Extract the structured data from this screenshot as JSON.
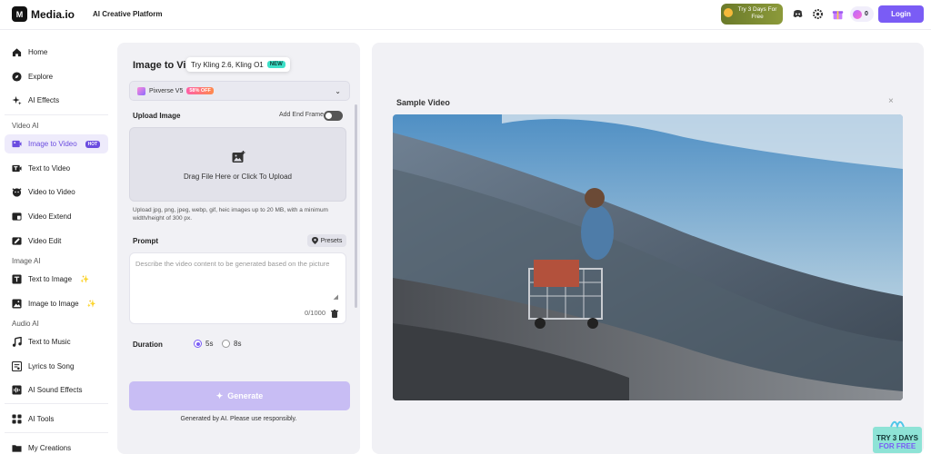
{
  "header": {
    "logo": "Media.io",
    "platform": "AI Creative Platform",
    "promo": "Try 3 Days For Free",
    "credits": "0",
    "login": "Login"
  },
  "sidebar": {
    "items": [
      {
        "label": "Home",
        "icon": "home-icon"
      },
      {
        "label": "Explore",
        "icon": "compass-icon"
      },
      {
        "label": "AI Effects",
        "icon": "sparkles-icon"
      }
    ],
    "sections": [
      {
        "title": "Video AI",
        "items": [
          {
            "label": "Image to Video",
            "badge": "HOT",
            "active": true
          },
          {
            "label": "Text to Video"
          },
          {
            "label": "Video to Video"
          },
          {
            "label": "Video Extend"
          },
          {
            "label": "Video Edit"
          }
        ]
      },
      {
        "title": "Image AI",
        "items": [
          {
            "label": "Text to Image"
          },
          {
            "label": "Image to Image"
          }
        ]
      },
      {
        "title": "Audio AI",
        "items": [
          {
            "label": "Text to Music"
          },
          {
            "label": "Lyrics to Song"
          },
          {
            "label": "AI Sound Effects"
          }
        ]
      }
    ],
    "tools": "AI Tools",
    "creations": "My Creations"
  },
  "panel": {
    "title": "Image to Vi",
    "tooltip": "Try Kling 2.6, Kling O1",
    "tooltip_badge": "NEW",
    "model": "Pixverse V5",
    "model_discount": "58% OFF",
    "upload_label": "Upload Image",
    "end_frame_label": "Add End Frame",
    "dropzone_text": "Drag File Here or Click To Upload",
    "upload_hint": "Upload jpg, png, jpeg, webp, gif, heic images up to 20 MB, with a minimum width/height of 300 px.",
    "prompt_label": "Prompt",
    "presets": "Presets",
    "prompt_placeholder": "Describe the video content to be generated based on the picture",
    "char_count": "0/1000",
    "duration_label": "Duration",
    "duration_options": [
      "5s",
      "8s"
    ],
    "duration_selected": "5s",
    "generate": "Generate",
    "disclaimer": "Generated by AI. Please use responsibly."
  },
  "sample": {
    "title": "Sample Video"
  },
  "corner_promo": {
    "line1": "TRY 3 DAYS",
    "line2": "FOR FREE"
  },
  "colors": {
    "accent": "#7a5cf5",
    "active_bg": "#eeebfb",
    "panel_bg": "#f1f1f5",
    "generate_disabled": "#c8bdf4"
  }
}
